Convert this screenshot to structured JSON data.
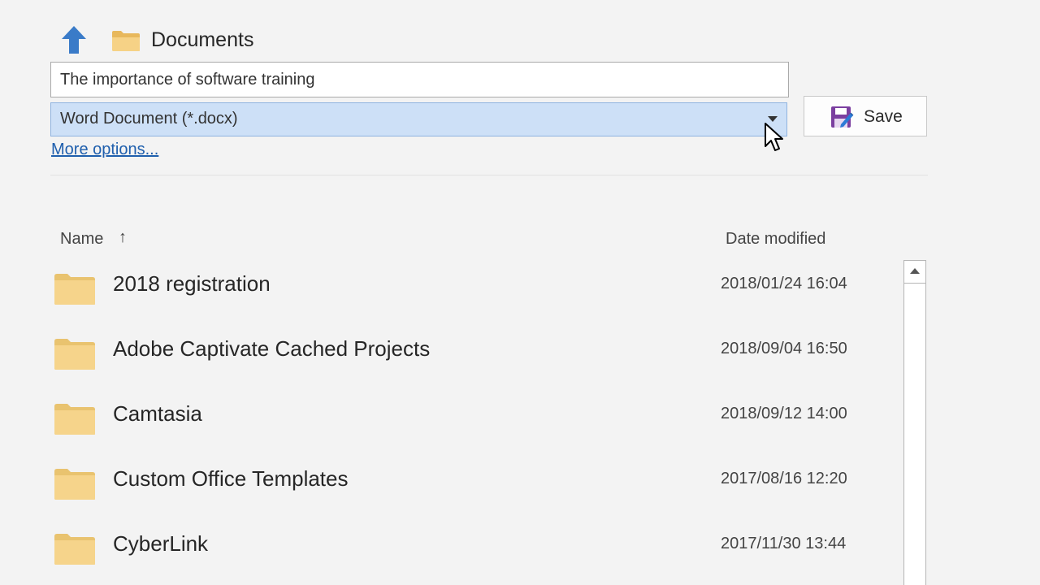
{
  "location": {
    "icon": "up-arrow-icon",
    "folder_icon": "folder-icon",
    "title": "Documents"
  },
  "filename": {
    "value": "The importance of software training"
  },
  "filetype": {
    "selected": "Word Document (*.docx)",
    "highlight_color": "#cde0f7"
  },
  "more_options": "More options...",
  "save_button": {
    "label": "Save",
    "icon": "save-as-icon"
  },
  "table": {
    "columns": {
      "name": "Name",
      "name_sort": "↑",
      "date": "Date modified"
    },
    "rows": [
      {
        "name": "2018 registration",
        "date": "2018/01/24 16:04"
      },
      {
        "name": "Adobe Captivate Cached Projects",
        "date": "2018/09/04 16:50"
      },
      {
        "name": "Camtasia",
        "date": "2018/09/12 14:00"
      },
      {
        "name": "Custom Office Templates",
        "date": "2017/08/16 12:20"
      },
      {
        "name": "CyberLink",
        "date": "2017/11/30 13:44"
      }
    ]
  },
  "colors": {
    "accent": "#1f5fad",
    "folder": "#f4cf7e",
    "background": "#f3f3f3"
  }
}
